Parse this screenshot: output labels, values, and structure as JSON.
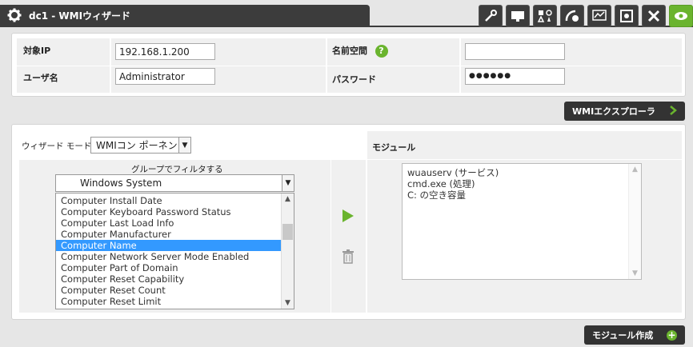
{
  "header": {
    "title": "dc1 - WMIウィザード",
    "icons": [
      "gear-icon",
      "probe-icon",
      "monitor-icon",
      "shapes-icon",
      "radar-icon",
      "graph-icon",
      "settings-icon",
      "tools-icon",
      "eye-icon"
    ]
  },
  "credentials": {
    "target_ip_label": "対象IP",
    "target_ip_value": "192.168.1.200",
    "namespace_label": "名前空間",
    "namespace_value": "",
    "username_label": "ユーザ名",
    "username_value": "Administrator",
    "password_label": "パスワード",
    "password_value": "●●●●●●"
  },
  "wmi_explorer_button": "WMIエクスプローラ",
  "wizard": {
    "mode_label": "ウィザード モード:",
    "mode_value": "WMIコン ポーネント",
    "filter_label": "グループでフィルタする",
    "filter_value": "Windows System",
    "items": [
      "Computer Install Date",
      "Computer Keyboard Password Status",
      "Computer Last Load Info",
      "Computer Manufacturer",
      "Computer Name",
      "Computer Network Server Mode Enabled",
      "Computer Part of Domain",
      "Computer Reset Capability",
      "Computer Reset Count",
      "Computer Reset Limit"
    ],
    "selected_item": "Computer Name"
  },
  "modules": {
    "header": "モジュール",
    "items": [
      "wuauserv (サービス)",
      "cmd.exe (処理)",
      "C: の空き容量"
    ]
  },
  "create_module_button": "モジュール作成",
  "colors": {
    "dark": "#3c3c3c",
    "accent_green": "#6ab42e",
    "selection": "#3399ff"
  }
}
